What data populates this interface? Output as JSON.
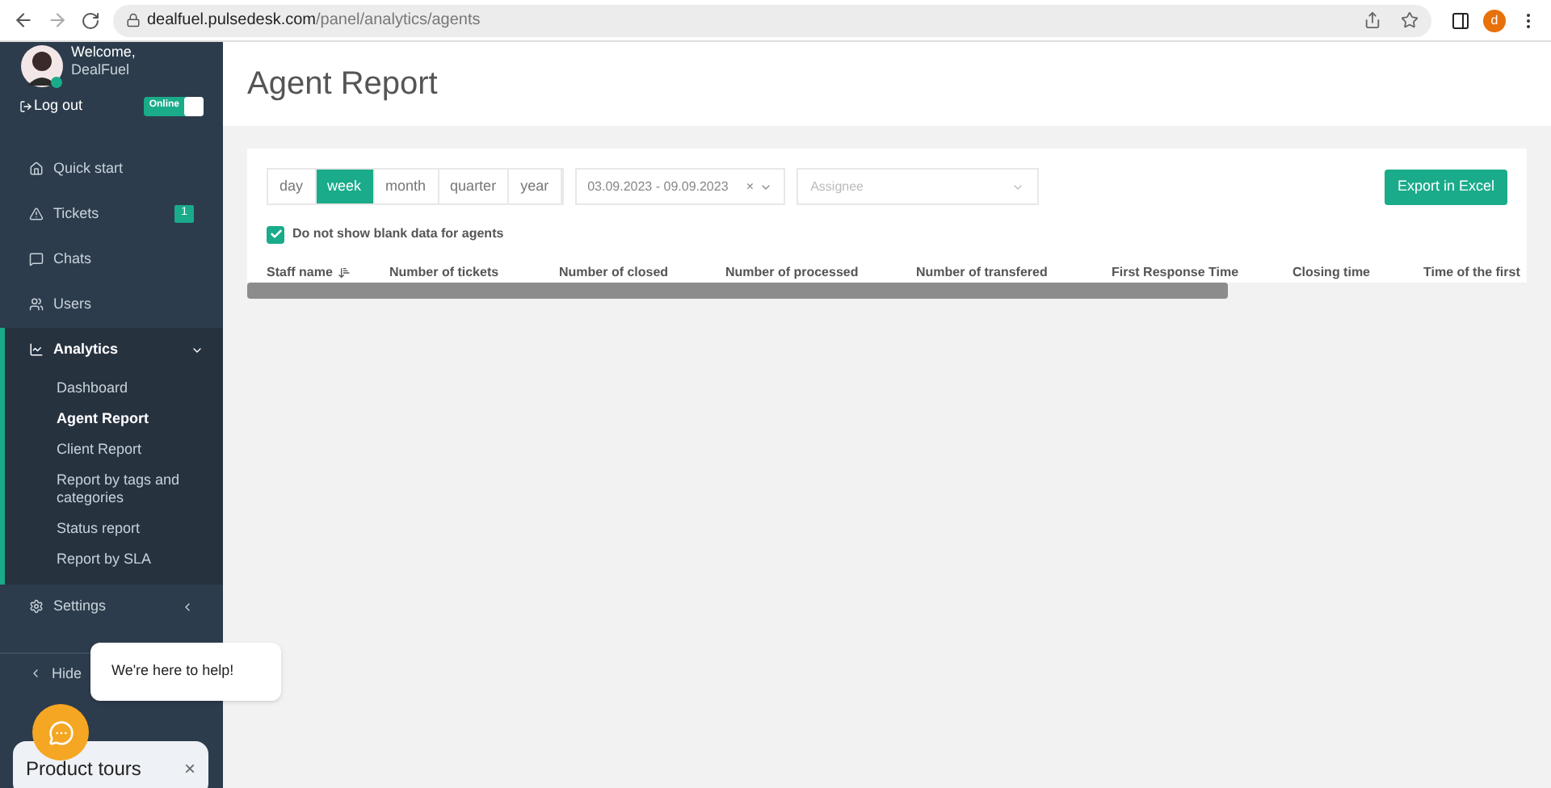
{
  "browser": {
    "url_host": "dealfuel.pulsedesk.com",
    "url_path": "/panel/analytics/agents",
    "profile_initial": "d"
  },
  "sidebar": {
    "welcome": "Welcome,",
    "user_name": "DealFuel",
    "logout": "Log out",
    "status": {
      "label": "Online",
      "on": true
    },
    "items": [
      {
        "label": "Quick start",
        "expanded": false
      },
      {
        "label": "Tickets",
        "badge": "1",
        "expanded": false
      },
      {
        "label": "Chats",
        "expanded": false
      },
      {
        "label": "Users",
        "expanded": false
      },
      {
        "label": "Analytics",
        "expanded": true,
        "children": [
          {
            "label": "Dashboard",
            "selected": false
          },
          {
            "label": "Agent Report",
            "selected": true
          },
          {
            "label": "Client Report",
            "selected": false
          },
          {
            "label": "Report by tags and categories",
            "selected": false
          },
          {
            "label": "Status report",
            "selected": false
          },
          {
            "label": "Report by SLA",
            "selected": false
          }
        ]
      },
      {
        "label": "Settings",
        "expanded": false
      }
    ],
    "hide": "Hide"
  },
  "page_title": "Agent Report",
  "periods": [
    {
      "label": "day",
      "selected": false
    },
    {
      "label": "week",
      "selected": true
    },
    {
      "label": "month",
      "selected": false
    },
    {
      "label": "quarter",
      "selected": false
    },
    {
      "label": "year",
      "selected": false
    }
  ],
  "date_range": {
    "value": "03.09.2023 - 09.09.2023",
    "clear": "×"
  },
  "assignee": {
    "placeholder": "Assignee"
  },
  "export_button": "Export in Excel",
  "blank_filter": {
    "label": "Do not show blank data for agents",
    "checked": true
  },
  "table": {
    "columns": [
      "Staff name",
      "Number of tickets",
      "Number of closed",
      "Number of processed",
      "Number of transfered",
      "First Response Time",
      "Closing time",
      "Time of the first"
    ]
  },
  "help_bubble": "We're here to help!",
  "product_tours": {
    "label": "Product tours",
    "close": "×"
  }
}
